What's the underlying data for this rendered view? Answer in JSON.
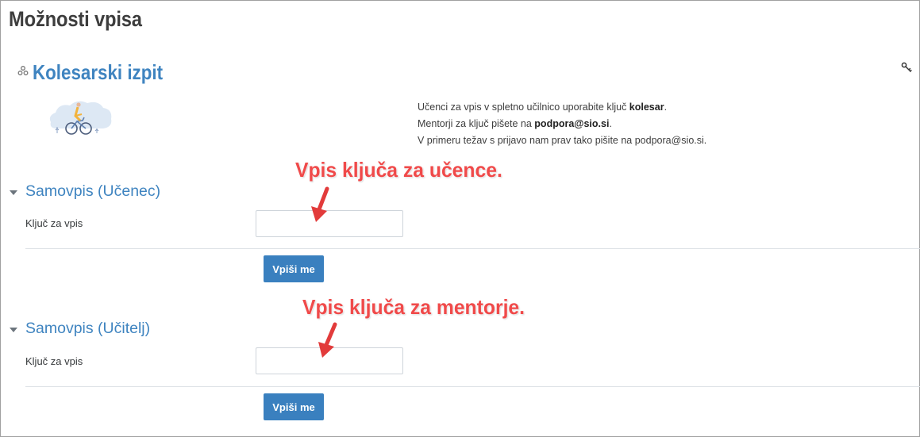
{
  "page": {
    "title": "Možnosti vpisa"
  },
  "course": {
    "title": "Kolesarski izpit",
    "icon": "course-icon",
    "key_icon": "key-icon",
    "summary": {
      "line1_prefix": "Učenci za vpis v spletno učilnico uporabite ključ ",
      "line1_bold": "kolesar",
      "line1_suffix": ".",
      "line2_prefix": "Mentorji za ključ pišete na ",
      "line2_bold": "podpora@sio.si",
      "line2_suffix": ".",
      "line3": "V primeru težav s prijavo nam prav tako pišite na podpora@sio.si."
    }
  },
  "sections": [
    {
      "title": "Samovpis (Učenec)",
      "field_label": "Ključ za vpis",
      "field_value": "",
      "button_label": "Vpiši me"
    },
    {
      "title": "Samovpis (Učitelj)",
      "field_label": "Ključ za vpis",
      "field_value": "",
      "button_label": "Vpiši me"
    }
  ],
  "annotations": [
    {
      "text": "Vpis ključa za učence."
    },
    {
      "text": "Vpis ključa za mentorje."
    }
  ],
  "colors": {
    "accent": "#3f84c0",
    "button": "#3a80bf",
    "annotation": "#f04a4a"
  }
}
